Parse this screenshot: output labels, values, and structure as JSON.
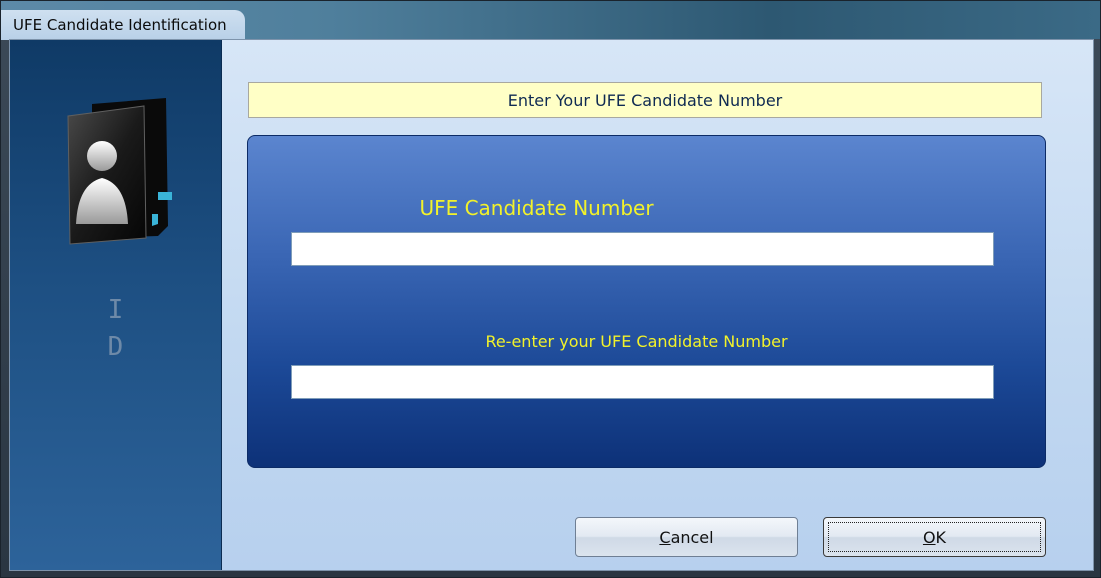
{
  "window": {
    "title": "UFE Candidate Identification"
  },
  "sidebar": {
    "icon": "user-folder-icon",
    "letter_1": "I",
    "letter_2": "D"
  },
  "banner": {
    "text": "Enter Your UFE Candidate Number"
  },
  "form": {
    "field_1_label": "UFE Candidate Number",
    "field_1_value": "",
    "field_2_label": "Re-enter your UFE Candidate Number",
    "field_2_value": ""
  },
  "buttons": {
    "cancel_mnemonic": "C",
    "cancel_rest": "ancel",
    "ok_mnemonic": "O",
    "ok_rest": "K"
  },
  "colors": {
    "label_yellow": "#f2f22a",
    "banner_bg": "#ffffc6",
    "panel_blue": "#1c4997",
    "sidebar_blue": "#1d4f82"
  }
}
